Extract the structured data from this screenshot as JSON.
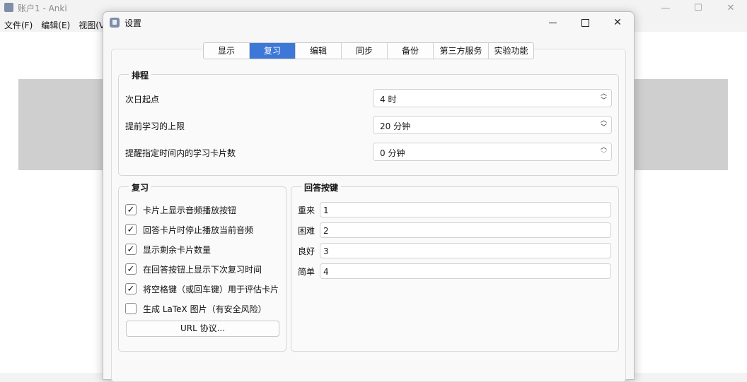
{
  "main_window": {
    "title": "账户1 - Anki",
    "menu": [
      "文件(F)",
      "编辑(E)",
      "视图(V"
    ],
    "controls": {
      "minimize": "—",
      "maximize": "☐",
      "close": "✕"
    }
  },
  "dialog": {
    "title": "设置",
    "controls": {
      "close": "✕"
    }
  },
  "tabs": [
    {
      "label": "显示",
      "active": false
    },
    {
      "label": "复习",
      "active": true
    },
    {
      "label": "编辑",
      "active": false
    },
    {
      "label": "同步",
      "active": false
    },
    {
      "label": "备份",
      "active": false
    },
    {
      "label": "第三方服务",
      "active": false
    },
    {
      "label": "实验功能",
      "active": false
    }
  ],
  "scheduling": {
    "title": "排程",
    "rows": [
      {
        "label": "次日起点",
        "value": "4 时"
      },
      {
        "label": "提前学习的上限",
        "value": "20 分钟"
      },
      {
        "label": "提醒指定时间内的学习卡片数",
        "value": "0 分钟"
      }
    ]
  },
  "review": {
    "title": "复习",
    "checks": [
      {
        "label": "卡片上显示音频播放按钮",
        "checked": true
      },
      {
        "label": "回答卡片时停止播放当前音频",
        "checked": true
      },
      {
        "label": "显示剩余卡片数量",
        "checked": true
      },
      {
        "label": "在回答按钮上显示下次复习时间",
        "checked": true
      },
      {
        "label": "将空格键（或回车键）用于评估卡片",
        "checked": true
      },
      {
        "label": "生成 LaTeX 图片（有安全风险）",
        "checked": false
      }
    ],
    "url_button": "URL 协议..."
  },
  "answer_keys": {
    "title": "回答按键",
    "rows": [
      {
        "label": "重来",
        "value": "1"
      },
      {
        "label": "困难",
        "value": "2"
      },
      {
        "label": "良好",
        "value": "3"
      },
      {
        "label": "简单",
        "value": "4"
      }
    ]
  },
  "colors": {
    "accent": "#3d78d8"
  }
}
